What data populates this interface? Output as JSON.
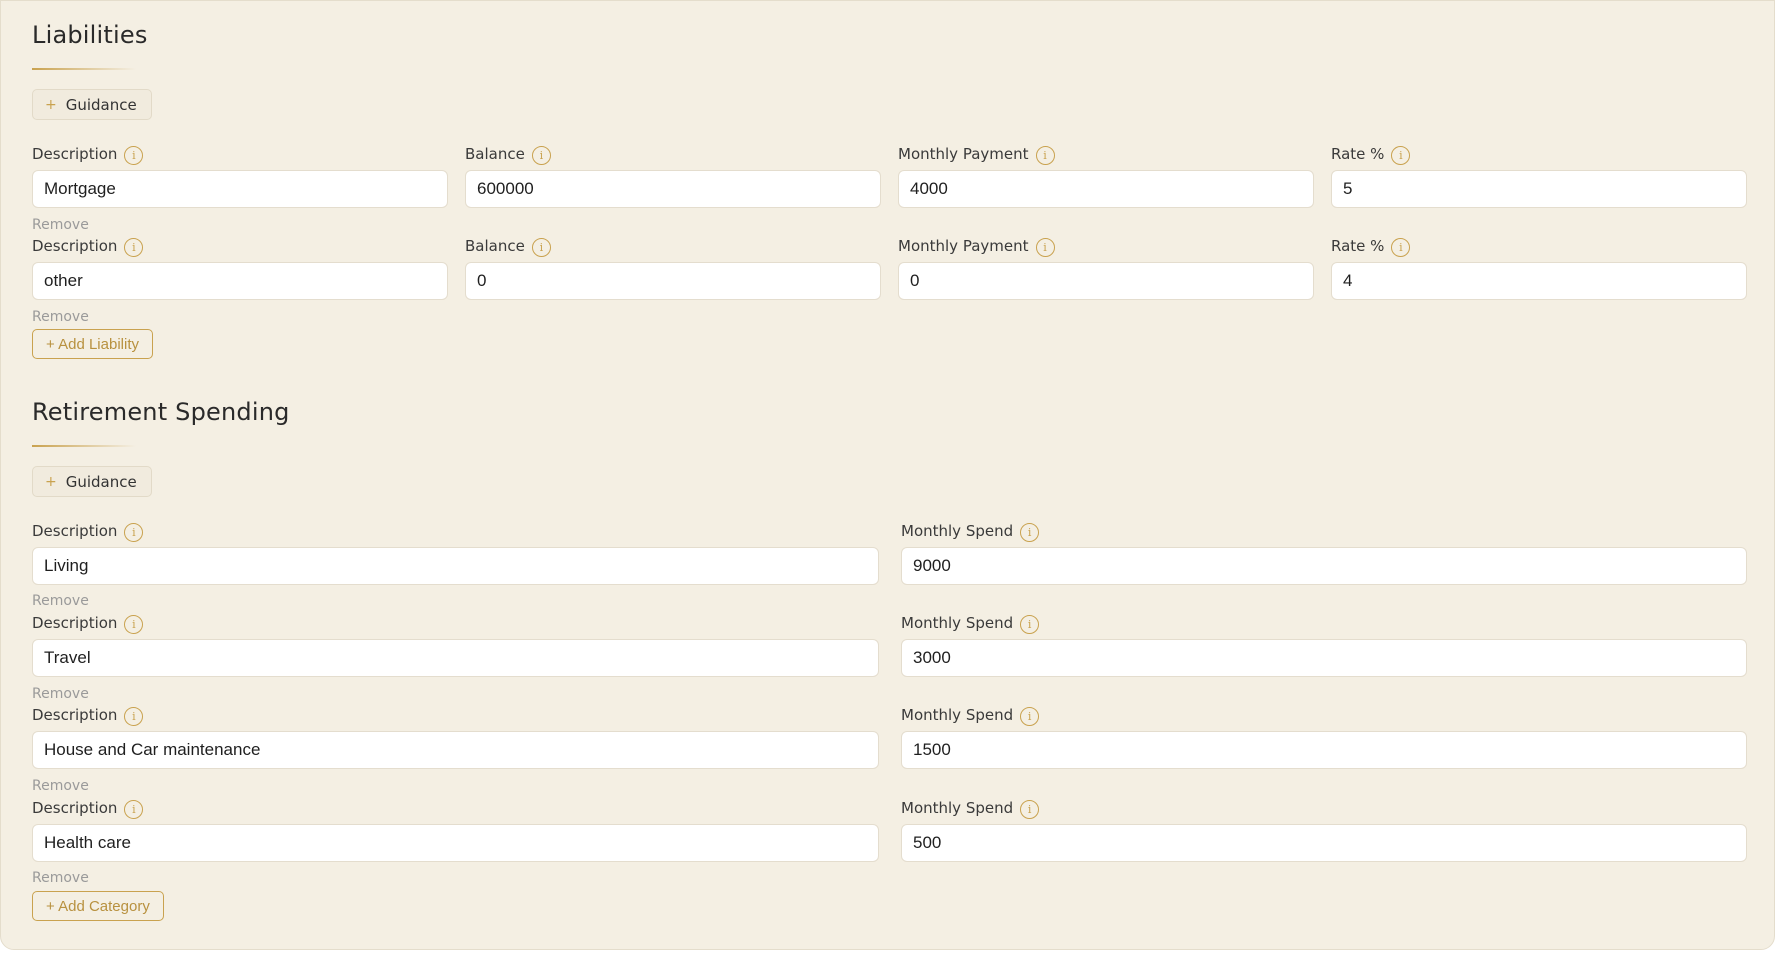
{
  "liabilities": {
    "title": "Liabilities",
    "guidance_label": "Guidance",
    "labels": {
      "description": "Description",
      "balance": "Balance",
      "monthly_payment": "Monthly Payment",
      "rate": "Rate %"
    },
    "rows": [
      {
        "description": "Mortgage",
        "balance": "600000",
        "monthly_payment": "4000",
        "rate": "5",
        "remove_label": "Remove"
      },
      {
        "description": "other",
        "balance": "0",
        "monthly_payment": "0",
        "rate": "4",
        "remove_label": "Remove"
      }
    ],
    "add_label": "+ Add Liability"
  },
  "retirement": {
    "title": "Retirement Spending",
    "guidance_label": "Guidance",
    "labels": {
      "description": "Description",
      "monthly_spend": "Monthly Spend"
    },
    "rows": [
      {
        "description": "Living",
        "monthly_spend": "9000",
        "remove_label": "Remove"
      },
      {
        "description": "Travel",
        "monthly_spend": "3000",
        "remove_label": "Remove"
      },
      {
        "description": "House and Car maintenance",
        "monthly_spend": "1500",
        "remove_label": "Remove"
      },
      {
        "description": "Health care",
        "monthly_spend": "500",
        "remove_label": "Remove"
      }
    ],
    "add_label": "+ Add Category"
  },
  "icons": {
    "info": "info-icon",
    "plus": "plus-icon"
  },
  "colors": {
    "background": "#f4efe3",
    "accent": "#c9a24f",
    "input_bg": "#ffffff",
    "muted_text": "#9a9a9a"
  }
}
